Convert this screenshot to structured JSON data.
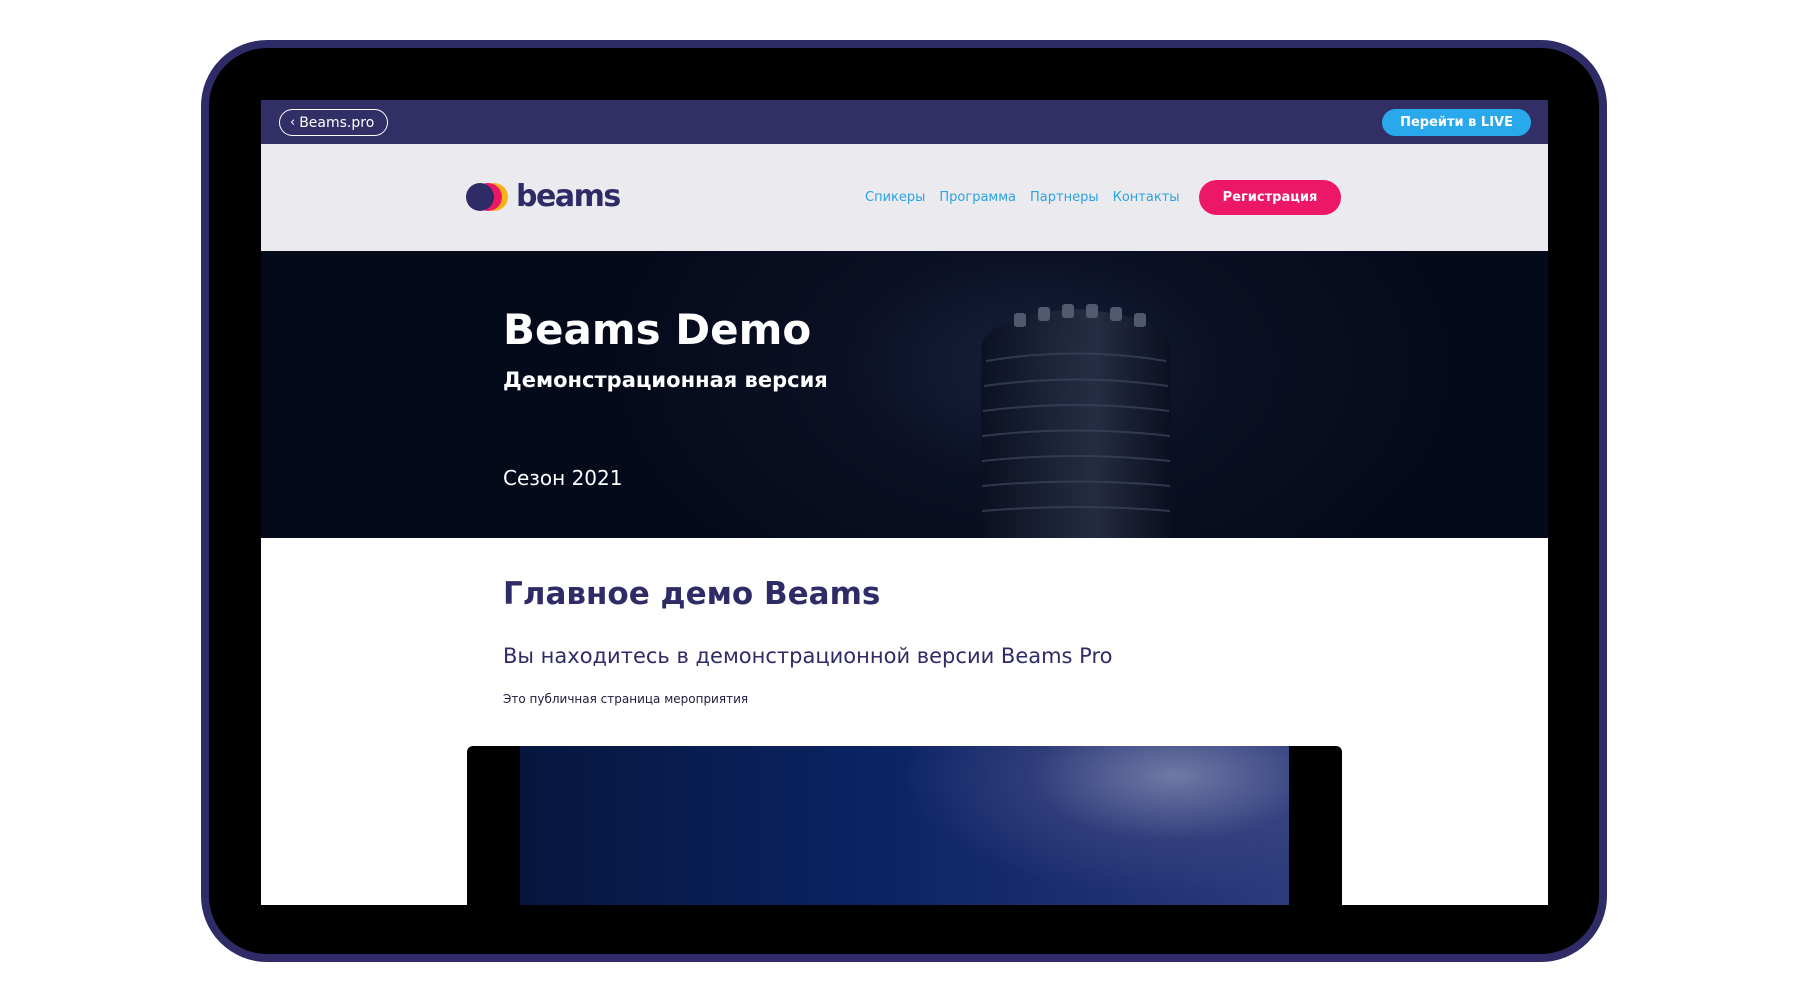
{
  "topbar": {
    "back_label": "Beams.pro",
    "live_label": "Перейти в LIVE"
  },
  "header": {
    "logo_text": "beams",
    "nav": [
      "Спикеры",
      "Программа",
      "Партнеры",
      "Контакты"
    ],
    "register_label": "Регистрация"
  },
  "hero": {
    "title": "Beams Demo",
    "subtitle": "Демонстрационная версия",
    "season": "Сезон 2021"
  },
  "content": {
    "title": "Главное демо Beams",
    "lead": "Вы находитесь в демонстрационной версии Beams Pro",
    "note": "Это публичная страница мероприятия"
  },
  "colors": {
    "frame": "#2f2b66",
    "topbar": "#312f66",
    "header_bg": "#ebebef",
    "nav_link": "#2aa3e2",
    "register": "#ec1766",
    "live": "#29a9eb",
    "heading": "#2f2b66"
  },
  "icons": {
    "back": "chevron-left-icon",
    "logo": "beams-logo-icon"
  }
}
